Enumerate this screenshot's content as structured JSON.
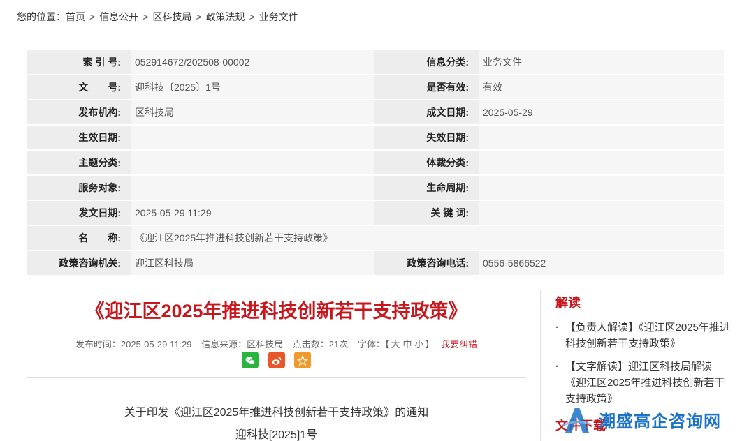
{
  "breadcrumb": {
    "prefix": "您的位置：",
    "items": [
      "首页",
      "信息公开",
      "区科技局",
      "政策法规",
      "业务文件"
    ],
    "separator": ">"
  },
  "meta": {
    "rows": [
      [
        {
          "label": "索 引 号:",
          "value": "052914672/202508-00002"
        },
        {
          "label": "信息分类:",
          "value": "业务文件"
        }
      ],
      [
        {
          "label": "文　　号:",
          "value": "迎科技〔2025〕1号"
        },
        {
          "label": "是否有效:",
          "value": "有效"
        }
      ],
      [
        {
          "label": "发布机构:",
          "value": "区科技局"
        },
        {
          "label": "成文日期:",
          "value": "2025-05-29"
        }
      ],
      [
        {
          "label": "生效日期:",
          "value": ""
        },
        {
          "label": "失效日期:",
          "value": ""
        }
      ],
      [
        {
          "label": "主题分类:",
          "value": ""
        },
        {
          "label": "体裁分类:",
          "value": ""
        }
      ],
      [
        {
          "label": "服务对象:",
          "value": ""
        },
        {
          "label": "生命周期:",
          "value": ""
        }
      ],
      [
        {
          "label": "发文日期:",
          "value": "2025-05-29 11:29"
        },
        {
          "label": "关 键 词:",
          "value": ""
        }
      ],
      [
        {
          "label": "名　　称:",
          "value": "《迎江区2025年推进科技创新若干支持政策》"
        }
      ],
      [
        {
          "label": "政策咨询机关:",
          "value": "迎江区科技局"
        },
        {
          "label": "政策咨询电话:",
          "value": "0556-5866522"
        }
      ]
    ]
  },
  "article": {
    "title": "《迎江区2025年推进科技创新若干支持政策》",
    "publish_time": "发布时间：2025-05-29 11:29",
    "source": "信息来源：区科技局",
    "clicks": "点击数：21次",
    "font_label": "字体：",
    "font_bracket_open": "【",
    "font_sizes": [
      "大",
      "中",
      "小"
    ],
    "font_bracket_close": "】",
    "correction": "我要纠错",
    "notice_title": "关于印发《迎江区2025年推进科技创新若干支持政策》的通知",
    "doc_number": "迎科技[2025]1号"
  },
  "share": {
    "icons": [
      "wechat-icon",
      "weibo-icon",
      "star-icon"
    ],
    "colors": {
      "wechat": "#27b53e",
      "weibo": "#e8562a",
      "favorite": "#f19a2a"
    }
  },
  "sidebar": {
    "heading": "解读",
    "items": [
      "【负责人解读】《迎江区2025年推进科技创新若干支持政策》",
      "【文字解读】迎江区科技局解读《迎江区2025年推进科技创新若干支持政策》"
    ],
    "heading_2": "文件下载"
  },
  "watermark": {
    "text": "潮盛高企咨询网"
  },
  "colors": {
    "accent": "#c8161d",
    "watermark": "#1a73c7"
  }
}
